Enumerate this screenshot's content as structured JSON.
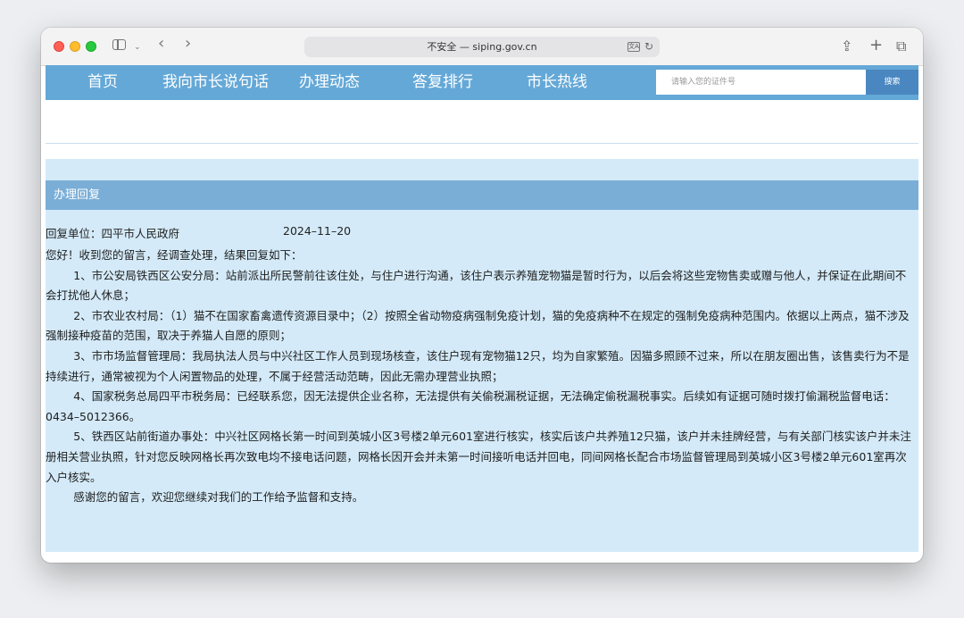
{
  "browser": {
    "address_text": "不安全 — siping.gov.cn"
  },
  "nav": {
    "items": [
      "首页",
      "我向市长说句话",
      "办理动态",
      "答复排行",
      "市长热线"
    ],
    "search_placeholder": "请输入您的证件号",
    "search_button": "搜索"
  },
  "reply": {
    "section_title": "办理回复",
    "unit": "回复单位：四平市人民政府",
    "date": "2024–11–20",
    "paragraphs": [
      "您好！收到您的留言，经调查处理，结果回复如下：",
      "1、市公安局铁西区公安分局：站前派出所民警前往该住处，与住户进行沟通，该住户表示养殖宠物猫是暂时行为，以后会将这些宠物售卖或赠与他人，并保证在此期间不会打扰他人休息；",
      "2、市农业农村局：（1）猫不在国家畜禽遗传资源目录中；（2）按照全省动物疫病强制免疫计划，猫的免疫病种不在规定的强制免疫病种范围内。依据以上两点，猫不涉及强制接种疫苗的范围，取决于养猫人自愿的原则；",
      "3、市市场监督管理局：我局执法人员与中兴社区工作人员到现场核查，该住户现有宠物猫12只，均为自家繁殖。因猫多照顾不过来，所以在朋友圈出售，该售卖行为不是持续进行，通常被视为个人闲置物品的处理，不属于经营活动范畴，因此无需办理营业执照；",
      "4、国家税务总局四平市税务局：已经联系您，因无法提供企业名称，无法提供有关偷税漏税证据，无法确定偷税漏税事实。后续如有证据可随时拨打偷漏税监督电话：0434–5012366。",
      "5、铁西区站前街道办事处：中兴社区网格长第一时间到英城小区3号楼2单元601室进行核实，核实后该户共养殖12只猫，该户并未挂牌经营，与有关部门核实该户并未注册相关营业执照，针对您反映网格长再次致电均不接电话问题，网格长因开会并未第一时间接听电话并回电，同间网格长配合市场监督管理局到英城小区3号楼2单元601室再次入户核实。",
      "感谢您的留言，欢迎您继续对我们的工作给予监督和支持。"
    ]
  }
}
